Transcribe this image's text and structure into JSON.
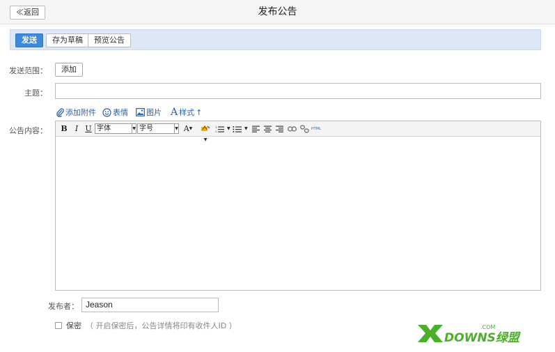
{
  "header": {
    "back_label": "≪返回",
    "title": "发布公告"
  },
  "toolbar": {
    "send_label": "发送",
    "save_draft_label": "存为草稿",
    "preview_label": "预览公告"
  },
  "form": {
    "scope_label": "发送范围：",
    "add_label": "添加",
    "subject_label": "主题：",
    "subject_value": "",
    "content_label": "公告内容：",
    "publisher_label": "发布者：",
    "publisher_value": "Jeason",
    "secret_label": "保密",
    "secret_hint": "（ 开启保密后，公告详情将印有收件人ID ）"
  },
  "attach": {
    "attachment": "添加附件",
    "emoji": "表情",
    "image": "图片",
    "style": "样式"
  },
  "editor_toolbar": {
    "bold": "B",
    "italic": "I",
    "underline": "U",
    "font_family": "字体",
    "font_size": "字号",
    "font_color": "A",
    "html": "HTML"
  },
  "watermark": {
    "text": "DOWNS绿盟",
    "sub": ".COM"
  },
  "colors": {
    "primary": "#3d8ad9",
    "toolbar_bg": "#dde8f6",
    "link": "#2a5fa8",
    "watermark_green": "#4caf2a"
  }
}
